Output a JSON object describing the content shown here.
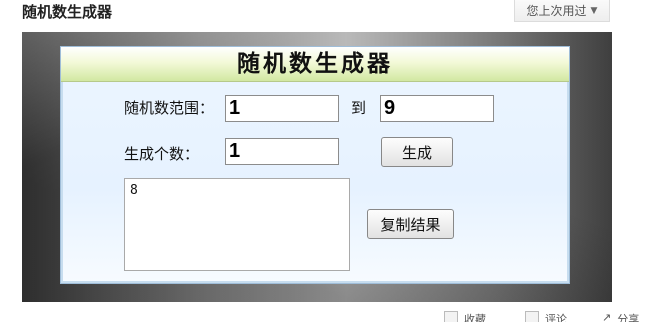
{
  "page": {
    "title": "随机数生成器"
  },
  "recent": {
    "label": "您上次用过",
    "arrow": "▼"
  },
  "app": {
    "title": "随机数生成器",
    "range_label": "随机数范围：",
    "to_label": "到",
    "min_value": "1",
    "max_value": "9",
    "count_label": "生成个数：",
    "count_value": "1",
    "generate_label": "生成",
    "result_value": "8",
    "copy_label": "复制结果"
  },
  "bottom": {
    "favorite_label": "收藏",
    "comment_label": "评论",
    "share_label": "分享"
  }
}
